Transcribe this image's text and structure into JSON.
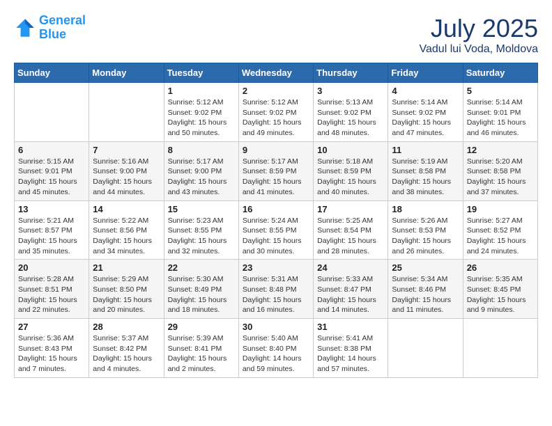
{
  "header": {
    "logo_line1": "General",
    "logo_line2": "Blue",
    "month": "July 2025",
    "location": "Vadul lui Voda, Moldova"
  },
  "days_of_week": [
    "Sunday",
    "Monday",
    "Tuesday",
    "Wednesday",
    "Thursday",
    "Friday",
    "Saturday"
  ],
  "weeks": [
    [
      {
        "day": "",
        "info": ""
      },
      {
        "day": "",
        "info": ""
      },
      {
        "day": "1",
        "info": "Sunrise: 5:12 AM\nSunset: 9:02 PM\nDaylight: 15 hours and 50 minutes."
      },
      {
        "day": "2",
        "info": "Sunrise: 5:12 AM\nSunset: 9:02 PM\nDaylight: 15 hours and 49 minutes."
      },
      {
        "day": "3",
        "info": "Sunrise: 5:13 AM\nSunset: 9:02 PM\nDaylight: 15 hours and 48 minutes."
      },
      {
        "day": "4",
        "info": "Sunrise: 5:14 AM\nSunset: 9:02 PM\nDaylight: 15 hours and 47 minutes."
      },
      {
        "day": "5",
        "info": "Sunrise: 5:14 AM\nSunset: 9:01 PM\nDaylight: 15 hours and 46 minutes."
      }
    ],
    [
      {
        "day": "6",
        "info": "Sunrise: 5:15 AM\nSunset: 9:01 PM\nDaylight: 15 hours and 45 minutes."
      },
      {
        "day": "7",
        "info": "Sunrise: 5:16 AM\nSunset: 9:00 PM\nDaylight: 15 hours and 44 minutes."
      },
      {
        "day": "8",
        "info": "Sunrise: 5:17 AM\nSunset: 9:00 PM\nDaylight: 15 hours and 43 minutes."
      },
      {
        "day": "9",
        "info": "Sunrise: 5:17 AM\nSunset: 8:59 PM\nDaylight: 15 hours and 41 minutes."
      },
      {
        "day": "10",
        "info": "Sunrise: 5:18 AM\nSunset: 8:59 PM\nDaylight: 15 hours and 40 minutes."
      },
      {
        "day": "11",
        "info": "Sunrise: 5:19 AM\nSunset: 8:58 PM\nDaylight: 15 hours and 38 minutes."
      },
      {
        "day": "12",
        "info": "Sunrise: 5:20 AM\nSunset: 8:58 PM\nDaylight: 15 hours and 37 minutes."
      }
    ],
    [
      {
        "day": "13",
        "info": "Sunrise: 5:21 AM\nSunset: 8:57 PM\nDaylight: 15 hours and 35 minutes."
      },
      {
        "day": "14",
        "info": "Sunrise: 5:22 AM\nSunset: 8:56 PM\nDaylight: 15 hours and 34 minutes."
      },
      {
        "day": "15",
        "info": "Sunrise: 5:23 AM\nSunset: 8:55 PM\nDaylight: 15 hours and 32 minutes."
      },
      {
        "day": "16",
        "info": "Sunrise: 5:24 AM\nSunset: 8:55 PM\nDaylight: 15 hours and 30 minutes."
      },
      {
        "day": "17",
        "info": "Sunrise: 5:25 AM\nSunset: 8:54 PM\nDaylight: 15 hours and 28 minutes."
      },
      {
        "day": "18",
        "info": "Sunrise: 5:26 AM\nSunset: 8:53 PM\nDaylight: 15 hours and 26 minutes."
      },
      {
        "day": "19",
        "info": "Sunrise: 5:27 AM\nSunset: 8:52 PM\nDaylight: 15 hours and 24 minutes."
      }
    ],
    [
      {
        "day": "20",
        "info": "Sunrise: 5:28 AM\nSunset: 8:51 PM\nDaylight: 15 hours and 22 minutes."
      },
      {
        "day": "21",
        "info": "Sunrise: 5:29 AM\nSunset: 8:50 PM\nDaylight: 15 hours and 20 minutes."
      },
      {
        "day": "22",
        "info": "Sunrise: 5:30 AM\nSunset: 8:49 PM\nDaylight: 15 hours and 18 minutes."
      },
      {
        "day": "23",
        "info": "Sunrise: 5:31 AM\nSunset: 8:48 PM\nDaylight: 15 hours and 16 minutes."
      },
      {
        "day": "24",
        "info": "Sunrise: 5:33 AM\nSunset: 8:47 PM\nDaylight: 15 hours and 14 minutes."
      },
      {
        "day": "25",
        "info": "Sunrise: 5:34 AM\nSunset: 8:46 PM\nDaylight: 15 hours and 11 minutes."
      },
      {
        "day": "26",
        "info": "Sunrise: 5:35 AM\nSunset: 8:45 PM\nDaylight: 15 hours and 9 minutes."
      }
    ],
    [
      {
        "day": "27",
        "info": "Sunrise: 5:36 AM\nSunset: 8:43 PM\nDaylight: 15 hours and 7 minutes."
      },
      {
        "day": "28",
        "info": "Sunrise: 5:37 AM\nSunset: 8:42 PM\nDaylight: 15 hours and 4 minutes."
      },
      {
        "day": "29",
        "info": "Sunrise: 5:39 AM\nSunset: 8:41 PM\nDaylight: 15 hours and 2 minutes."
      },
      {
        "day": "30",
        "info": "Sunrise: 5:40 AM\nSunset: 8:40 PM\nDaylight: 14 hours and 59 minutes."
      },
      {
        "day": "31",
        "info": "Sunrise: 5:41 AM\nSunset: 8:38 PM\nDaylight: 14 hours and 57 minutes."
      },
      {
        "day": "",
        "info": ""
      },
      {
        "day": "",
        "info": ""
      }
    ]
  ]
}
